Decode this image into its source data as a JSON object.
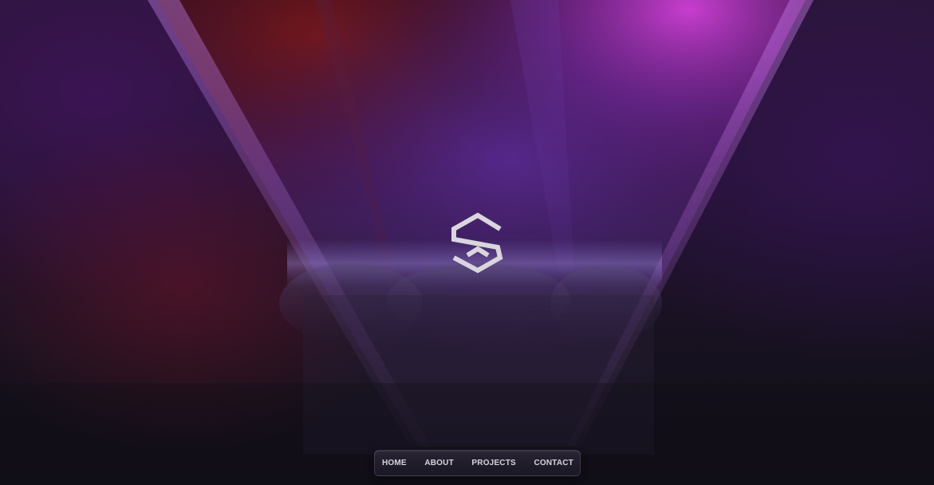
{
  "logo": {
    "icon": "hexagon-s-logo-icon",
    "color": "#d9d6de"
  },
  "nav": {
    "items": [
      {
        "label": "HOME"
      },
      {
        "label": "ABOUT"
      },
      {
        "label": "PROJECTS"
      },
      {
        "label": "CONTACT"
      }
    ]
  },
  "colors": {
    "background": "#120f1a",
    "beam_purple": "#8a3fc0",
    "beam_magenta": "#c13fd0",
    "beam_red": "#6e1420"
  }
}
